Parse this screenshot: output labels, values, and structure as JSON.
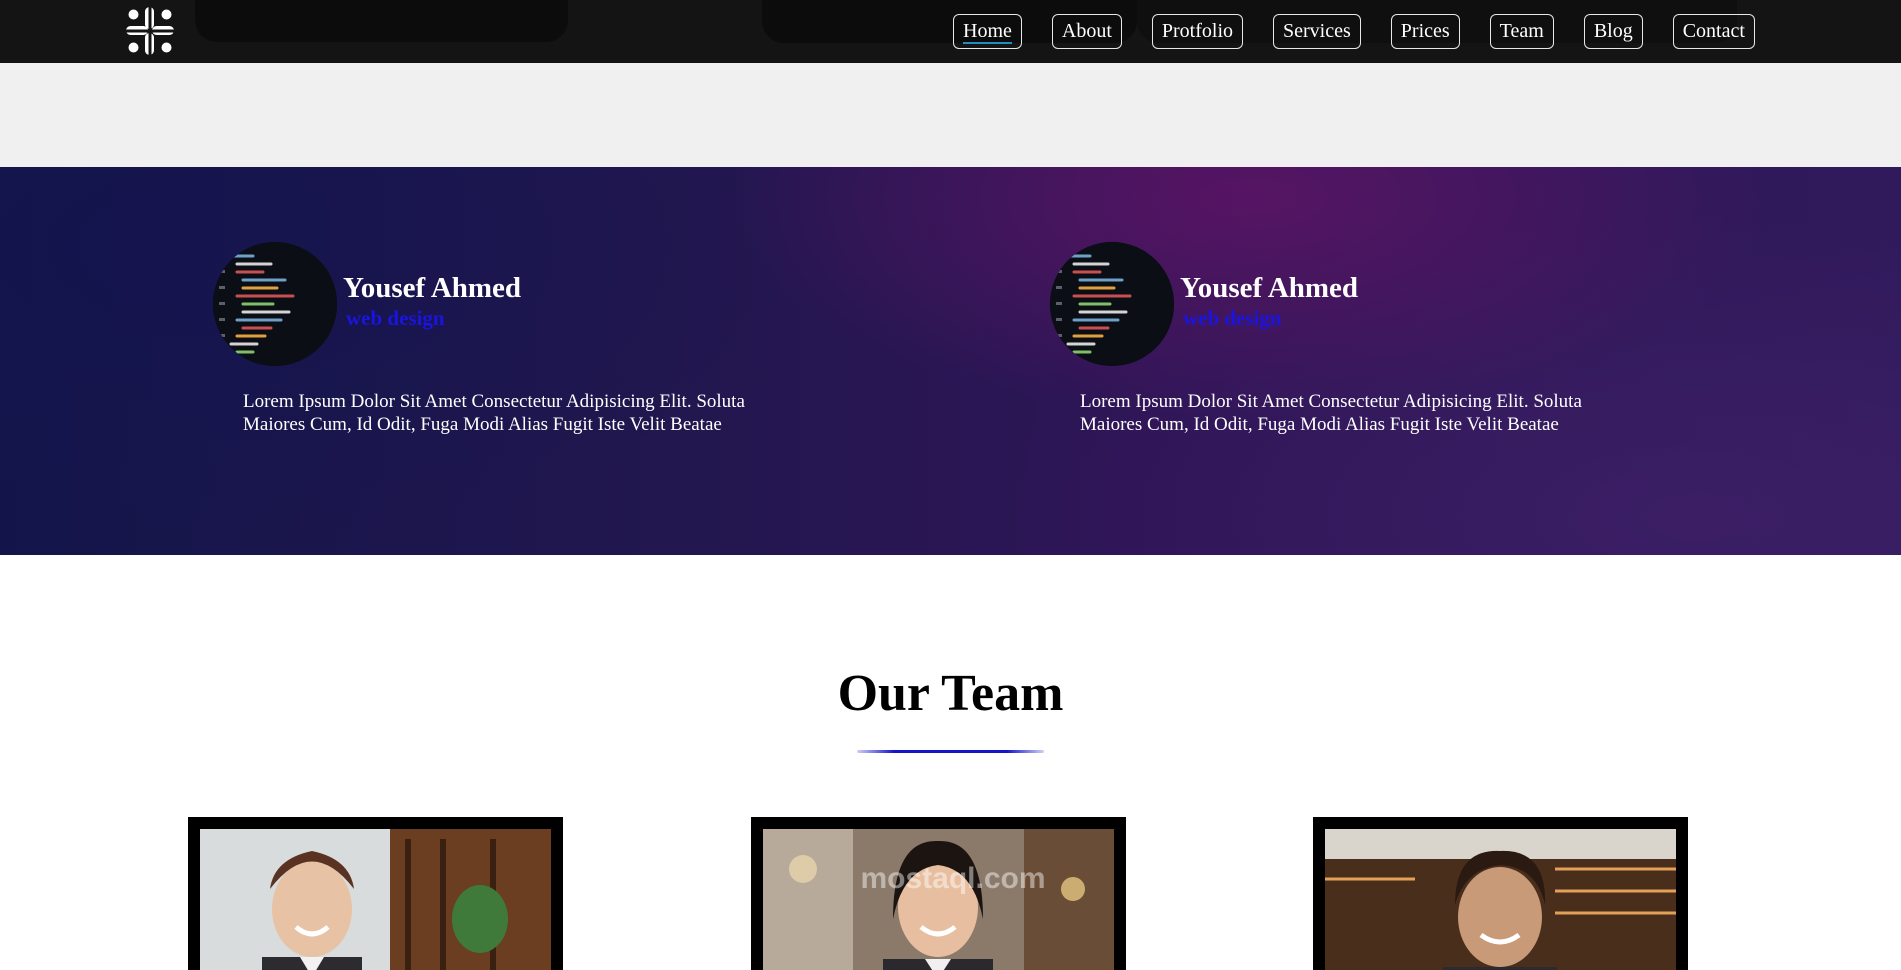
{
  "nav": {
    "items": [
      {
        "label": "Home",
        "active": true
      },
      {
        "label": "About",
        "active": false
      },
      {
        "label": "Protfolio",
        "active": false
      },
      {
        "label": "Services",
        "active": false
      },
      {
        "label": "Prices",
        "active": false
      },
      {
        "label": "Team",
        "active": false
      },
      {
        "label": "Blog",
        "active": false
      },
      {
        "label": "Contact",
        "active": false
      }
    ],
    "logo_icon": "slack-logo-icon",
    "accent_color": "#1e8fbf"
  },
  "testimonials": [
    {
      "name": "Yousef Ahmed",
      "role": "web design",
      "text": "Lorem Ipsum Dolor Sit Amet Consectetur Adipisicing Elit. Soluta Maiores Cum, Id Odit, Fuga Modi Alias Fugit Iste Velit Beatae"
    },
    {
      "name": "Yousef Ahmed",
      "role": "web design",
      "text": "Lorem Ipsum Dolor Sit Amet Consectetur Adipisicing Elit. Soluta Maiores Cum, Id Odit, Fuga Modi Alias Fugit Iste Velit Beatae"
    }
  ],
  "team": {
    "title": "Our Team",
    "underline_color": "#1414c8"
  },
  "watermark": "mostaql.com",
  "colors": {
    "role_text": "#1a14e0",
    "nav_bg": "#141414"
  }
}
